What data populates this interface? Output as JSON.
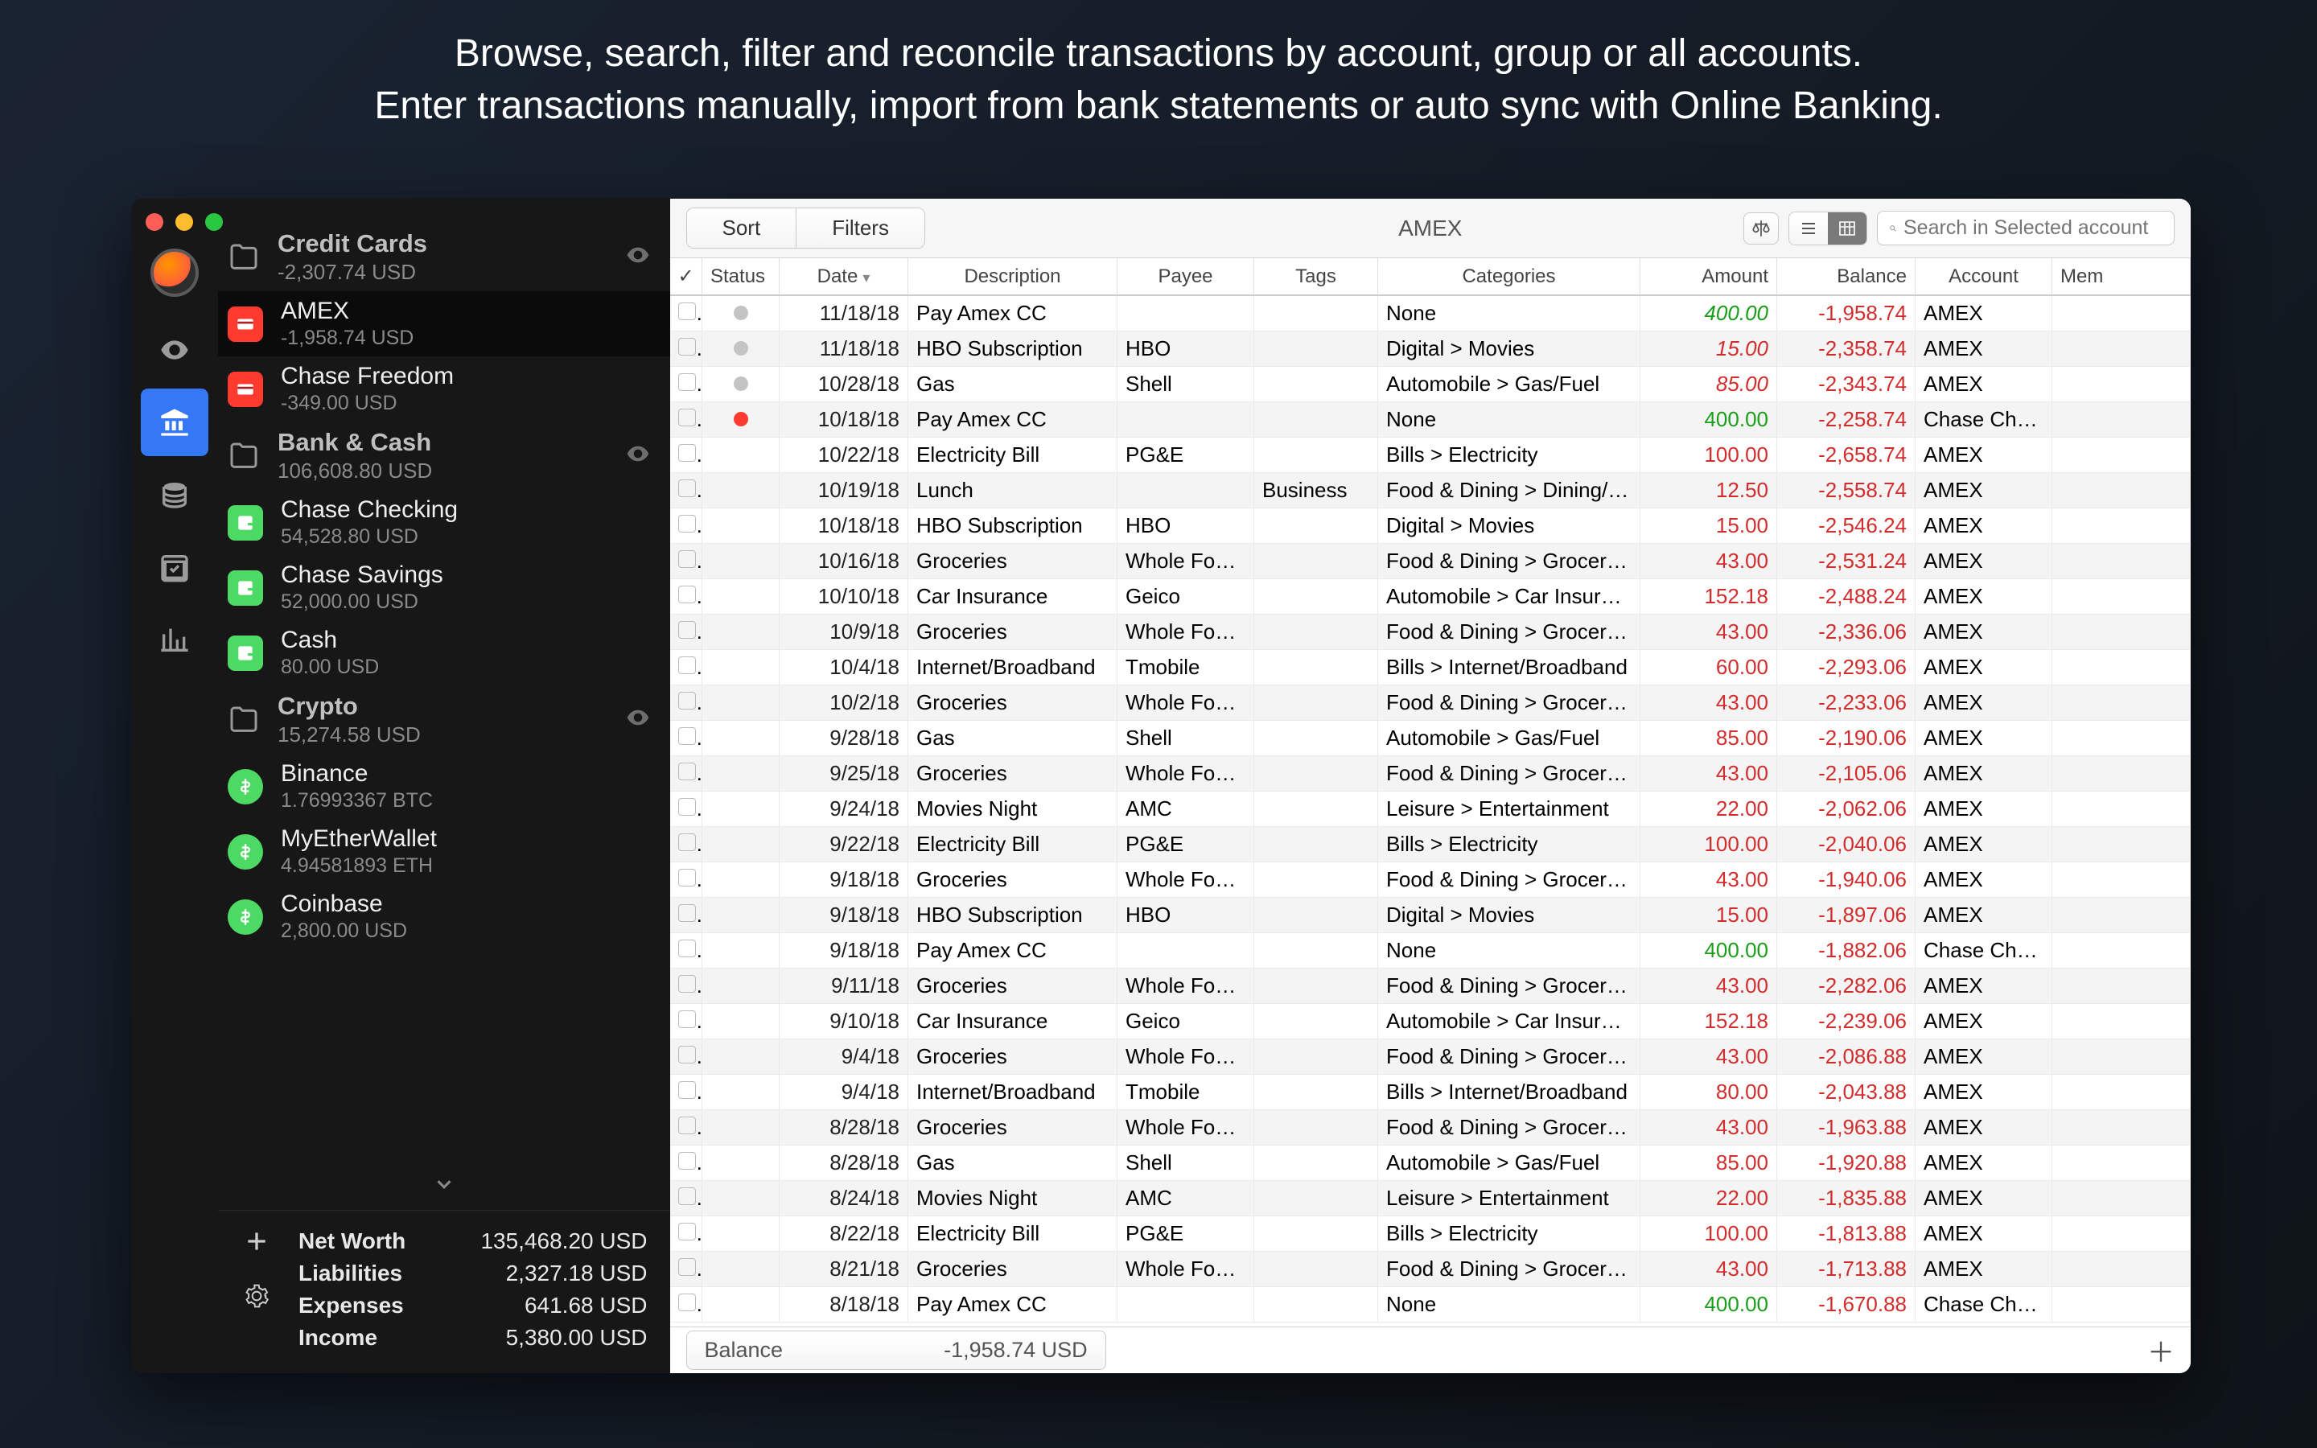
{
  "promo": {
    "line1": "Browse, search, filter and reconcile transactions by account, group or all accounts.",
    "line2": "Enter transactions manually, import from bank statements or auto sync with Online Banking."
  },
  "sidebar": {
    "groups": [
      {
        "name": "Credit Cards",
        "balance": "-2,307.74 USD",
        "visible": true,
        "accounts": [
          {
            "name": "AMEX",
            "balance": "-1,958.74 USD",
            "type": "cc",
            "selected": true
          },
          {
            "name": "Chase Freedom",
            "balance": "-349.00 USD",
            "type": "cc"
          }
        ]
      },
      {
        "name": "Bank & Cash",
        "balance": "106,608.80 USD",
        "visible": true,
        "accounts": [
          {
            "name": "Chase Checking",
            "balance": "54,528.80 USD",
            "type": "chk"
          },
          {
            "name": "Chase Savings",
            "balance": "52,000.00 USD",
            "type": "chk"
          },
          {
            "name": "Cash",
            "balance": "80.00 USD",
            "type": "chk"
          }
        ]
      },
      {
        "name": "Crypto",
        "balance": "15,274.58 USD",
        "visible": true,
        "accounts": [
          {
            "name": "Binance",
            "balance": "1.76993367 BTC",
            "type": "crypto"
          },
          {
            "name": "MyEtherWallet",
            "balance": "4.94581893 ETH",
            "type": "crypto"
          },
          {
            "name": "Coinbase",
            "balance": "2,800.00 USD",
            "type": "crypto"
          }
        ]
      }
    ],
    "summary": {
      "net_worth_label": "Net Worth",
      "net_worth": "135,468.20 USD",
      "liabilities_label": "Liabilities",
      "liabilities": "2,327.18 USD",
      "expenses_label": "Expenses",
      "expenses": "641.68 USD",
      "income_label": "Income",
      "income": "5,380.00 USD"
    }
  },
  "toolbar": {
    "sort_label": "Sort",
    "filters_label": "Filters",
    "account_title": "AMEX",
    "search_placeholder": "Search in Selected account"
  },
  "columns": {
    "check": "✓",
    "status": "Status",
    "date": "Date",
    "description": "Description",
    "payee": "Payee",
    "tags": "Tags",
    "categories": "Categories",
    "amount": "Amount",
    "balance": "Balance",
    "account": "Account",
    "memo": "Mem"
  },
  "transactions": [
    {
      "status": "gray",
      "date": "11/18/18",
      "desc": "Pay Amex CC",
      "payee": "",
      "tags": "",
      "cat": "None",
      "amount": "400.00",
      "amtcls": "posit",
      "balance": "-1,958.74",
      "account": "AMEX"
    },
    {
      "status": "gray",
      "date": "11/18/18",
      "desc": "HBO Subscription",
      "payee": "HBO",
      "tags": "",
      "cat": "Digital > Movies",
      "amount": "15.00",
      "amtcls": "negit",
      "balance": "-2,358.74",
      "account": "AMEX"
    },
    {
      "status": "gray",
      "date": "10/28/18",
      "desc": "Gas",
      "payee": "Shell",
      "tags": "",
      "cat": "Automobile > Gas/Fuel",
      "amount": "85.00",
      "amtcls": "negit",
      "balance": "-2,343.74",
      "account": "AMEX"
    },
    {
      "status": "red",
      "date": "10/18/18",
      "desc": "Pay Amex CC",
      "payee": "",
      "tags": "",
      "cat": "None",
      "amount": "400.00",
      "amtcls": "pos",
      "balance": "-2,258.74",
      "account": "Chase Ch…"
    },
    {
      "status": "",
      "date": "10/22/18",
      "desc": "Electricity Bill",
      "payee": "PG&E",
      "tags": "",
      "cat": "Bills > Electricity",
      "amount": "100.00",
      "amtcls": "neg",
      "balance": "-2,658.74",
      "account": "AMEX"
    },
    {
      "status": "",
      "date": "10/19/18",
      "desc": "Lunch",
      "payee": "",
      "tags": "Business",
      "cat": "Food & Dining > Dining/E…",
      "amount": "12.50",
      "amtcls": "neg",
      "balance": "-2,558.74",
      "account": "AMEX"
    },
    {
      "status": "",
      "date": "10/18/18",
      "desc": "HBO Subscription",
      "payee": "HBO",
      "tags": "",
      "cat": "Digital > Movies",
      "amount": "15.00",
      "amtcls": "neg",
      "balance": "-2,546.24",
      "account": "AMEX"
    },
    {
      "status": "",
      "date": "10/16/18",
      "desc": "Groceries",
      "payee": "Whole Foo…",
      "tags": "",
      "cat": "Food & Dining > Groceries",
      "amount": "43.00",
      "amtcls": "neg",
      "balance": "-2,531.24",
      "account": "AMEX"
    },
    {
      "status": "",
      "date": "10/10/18",
      "desc": "Car Insurance",
      "payee": "Geico",
      "tags": "",
      "cat": "Automobile > Car Insuran…",
      "amount": "152.18",
      "amtcls": "neg",
      "balance": "-2,488.24",
      "account": "AMEX"
    },
    {
      "status": "",
      "date": "10/9/18",
      "desc": "Groceries",
      "payee": "Whole Foo…",
      "tags": "",
      "cat": "Food & Dining > Groceries",
      "amount": "43.00",
      "amtcls": "neg",
      "balance": "-2,336.06",
      "account": "AMEX"
    },
    {
      "status": "",
      "date": "10/4/18",
      "desc": "Internet/Broadband",
      "payee": "Tmobile",
      "tags": "",
      "cat": "Bills > Internet/Broadband",
      "amount": "60.00",
      "amtcls": "neg",
      "balance": "-2,293.06",
      "account": "AMEX"
    },
    {
      "status": "",
      "date": "10/2/18",
      "desc": "Groceries",
      "payee": "Whole Foo…",
      "tags": "",
      "cat": "Food & Dining > Groceries",
      "amount": "43.00",
      "amtcls": "neg",
      "balance": "-2,233.06",
      "account": "AMEX"
    },
    {
      "status": "",
      "date": "9/28/18",
      "desc": "Gas",
      "payee": "Shell",
      "tags": "",
      "cat": "Automobile > Gas/Fuel",
      "amount": "85.00",
      "amtcls": "neg",
      "balance": "-2,190.06",
      "account": "AMEX"
    },
    {
      "status": "",
      "date": "9/25/18",
      "desc": "Groceries",
      "payee": "Whole Foo…",
      "tags": "",
      "cat": "Food & Dining > Groceries",
      "amount": "43.00",
      "amtcls": "neg",
      "balance": "-2,105.06",
      "account": "AMEX"
    },
    {
      "status": "",
      "date": "9/24/18",
      "desc": "Movies Night",
      "payee": "AMC",
      "tags": "",
      "cat": "Leisure > Entertainment",
      "amount": "22.00",
      "amtcls": "neg",
      "balance": "-2,062.06",
      "account": "AMEX"
    },
    {
      "status": "",
      "date": "9/22/18",
      "desc": "Electricity Bill",
      "payee": "PG&E",
      "tags": "",
      "cat": "Bills > Electricity",
      "amount": "100.00",
      "amtcls": "neg",
      "balance": "-2,040.06",
      "account": "AMEX"
    },
    {
      "status": "",
      "date": "9/18/18",
      "desc": "Groceries",
      "payee": "Whole Foo…",
      "tags": "",
      "cat": "Food & Dining > Groceries",
      "amount": "43.00",
      "amtcls": "neg",
      "balance": "-1,940.06",
      "account": "AMEX"
    },
    {
      "status": "",
      "date": "9/18/18",
      "desc": "HBO Subscription",
      "payee": "HBO",
      "tags": "",
      "cat": "Digital > Movies",
      "amount": "15.00",
      "amtcls": "neg",
      "balance": "-1,897.06",
      "account": "AMEX"
    },
    {
      "status": "",
      "date": "9/18/18",
      "desc": "Pay Amex CC",
      "payee": "",
      "tags": "",
      "cat": "None",
      "amount": "400.00",
      "amtcls": "pos",
      "balance": "-1,882.06",
      "account": "Chase Ch…"
    },
    {
      "status": "",
      "date": "9/11/18",
      "desc": "Groceries",
      "payee": "Whole Foo…",
      "tags": "",
      "cat": "Food & Dining > Groceries",
      "amount": "43.00",
      "amtcls": "neg",
      "balance": "-2,282.06",
      "account": "AMEX"
    },
    {
      "status": "",
      "date": "9/10/18",
      "desc": "Car Insurance",
      "payee": "Geico",
      "tags": "",
      "cat": "Automobile > Car Insuran…",
      "amount": "152.18",
      "amtcls": "neg",
      "balance": "-2,239.06",
      "account": "AMEX"
    },
    {
      "status": "",
      "date": "9/4/18",
      "desc": "Groceries",
      "payee": "Whole Foo…",
      "tags": "",
      "cat": "Food & Dining > Groceries",
      "amount": "43.00",
      "amtcls": "neg",
      "balance": "-2,086.88",
      "account": "AMEX"
    },
    {
      "status": "",
      "date": "9/4/18",
      "desc": "Internet/Broadband",
      "payee": "Tmobile",
      "tags": "",
      "cat": "Bills > Internet/Broadband",
      "amount": "80.00",
      "amtcls": "neg",
      "balance": "-2,043.88",
      "account": "AMEX"
    },
    {
      "status": "",
      "date": "8/28/18",
      "desc": "Groceries",
      "payee": "Whole Foo…",
      "tags": "",
      "cat": "Food & Dining > Groceries",
      "amount": "43.00",
      "amtcls": "neg",
      "balance": "-1,963.88",
      "account": "AMEX"
    },
    {
      "status": "",
      "date": "8/28/18",
      "desc": "Gas",
      "payee": "Shell",
      "tags": "",
      "cat": "Automobile > Gas/Fuel",
      "amount": "85.00",
      "amtcls": "neg",
      "balance": "-1,920.88",
      "account": "AMEX"
    },
    {
      "status": "",
      "date": "8/24/18",
      "desc": "Movies Night",
      "payee": "AMC",
      "tags": "",
      "cat": "Leisure > Entertainment",
      "amount": "22.00",
      "amtcls": "neg",
      "balance": "-1,835.88",
      "account": "AMEX"
    },
    {
      "status": "",
      "date": "8/22/18",
      "desc": "Electricity Bill",
      "payee": "PG&E",
      "tags": "",
      "cat": "Bills > Electricity",
      "amount": "100.00",
      "amtcls": "neg",
      "balance": "-1,813.88",
      "account": "AMEX"
    },
    {
      "status": "",
      "date": "8/21/18",
      "desc": "Groceries",
      "payee": "Whole Foo…",
      "tags": "",
      "cat": "Food & Dining > Groceries",
      "amount": "43.00",
      "amtcls": "neg",
      "balance": "-1,713.88",
      "account": "AMEX"
    },
    {
      "status": "",
      "date": "8/18/18",
      "desc": "Pay Amex CC",
      "payee": "",
      "tags": "",
      "cat": "None",
      "amount": "400.00",
      "amtcls": "pos",
      "balance": "-1,670.88",
      "account": "Chase Ch…"
    }
  ],
  "footer": {
    "balance_label": "Balance",
    "balance_value": "-1,958.74 USD"
  }
}
